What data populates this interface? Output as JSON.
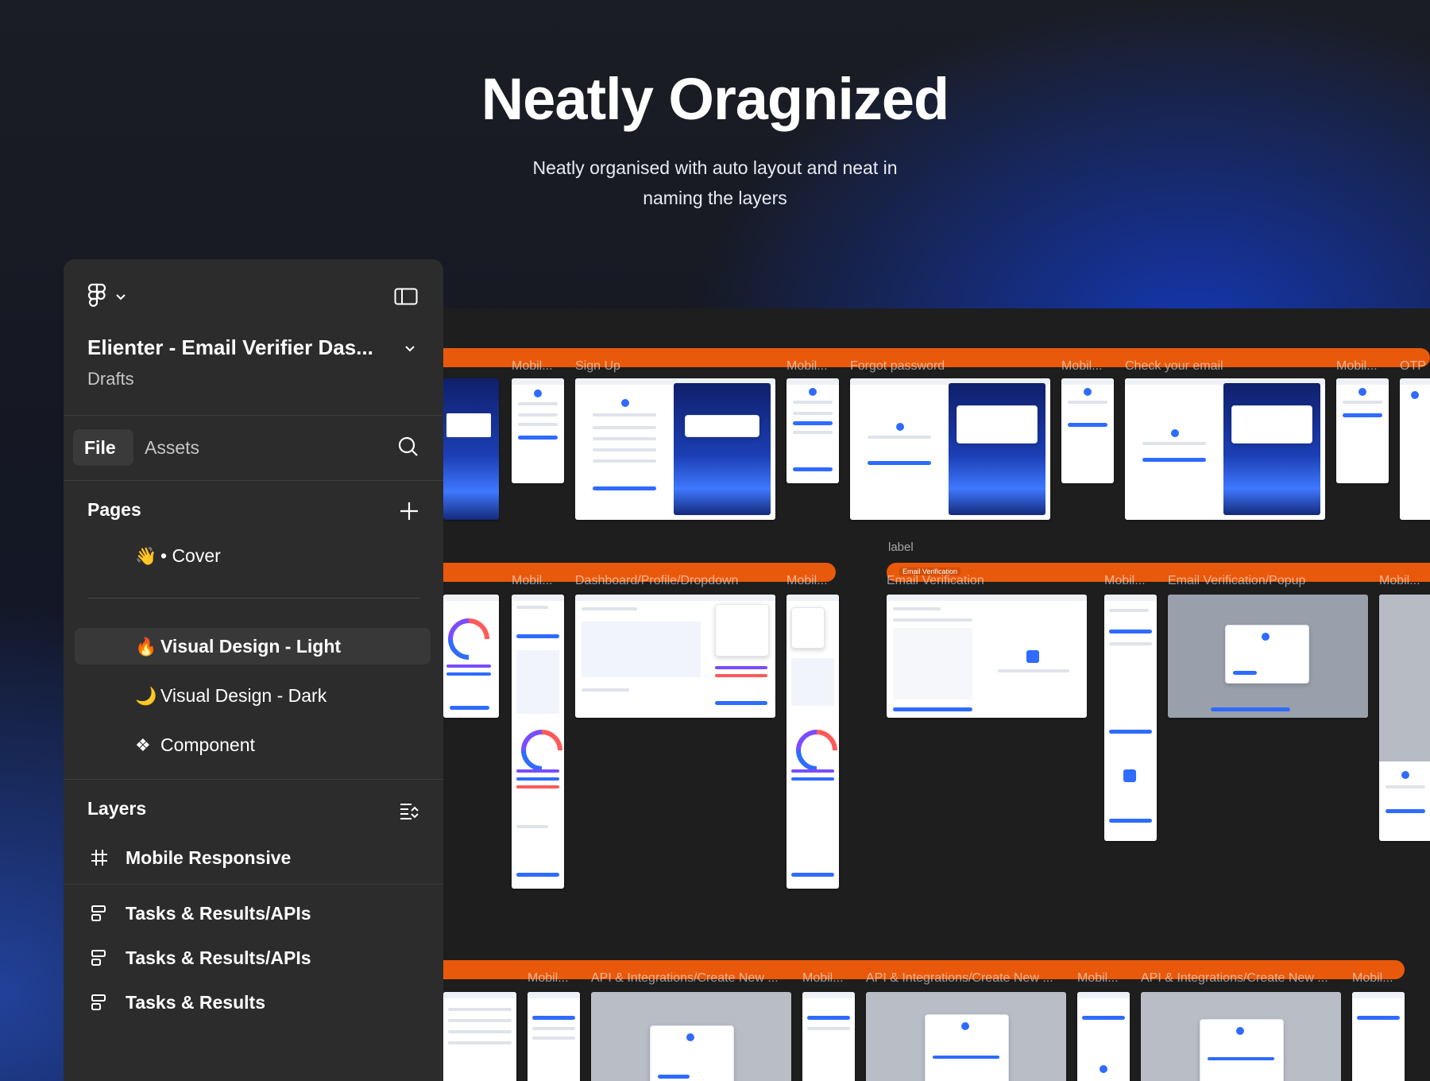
{
  "hero": {
    "title": "Neatly Oragnized",
    "subtitle_line1": "Neatly organised with auto layout and neat in",
    "subtitle_line2": "naming the layers"
  },
  "panel": {
    "file_name": "Elienter - Email Verifier Das...",
    "location": "Drafts",
    "tabs": [
      {
        "label": "File",
        "active": true
      },
      {
        "label": "Assets",
        "active": false
      }
    ],
    "pages_title": "Pages",
    "pages": [
      {
        "emoji": "👋",
        "label": "• Cover"
      },
      {
        "emoji": "🔥",
        "label": "Visual Design - Light",
        "selected": true
      },
      {
        "emoji": "🌙",
        "label": "Visual Design - Dark"
      },
      {
        "emoji": "❖",
        "label": "Component"
      }
    ],
    "layers_title": "Layers",
    "layers": [
      {
        "icon": "frame-grid-icon",
        "label": "Mobile Responsive"
      },
      {
        "icon": "auto-layout-icon",
        "label": "Tasks & Results/APIs"
      },
      {
        "icon": "auto-layout-icon",
        "label": "Tasks & Results/APIs"
      },
      {
        "icon": "auto-layout-icon",
        "label": "Tasks & Results"
      }
    ]
  },
  "canvas": {
    "row1_labels": [
      "Mobil...",
      "Sign Up",
      "Mobil...",
      "Forgot password",
      "Mobil...",
      "Check your email",
      "Mobil...",
      "OTP"
    ],
    "row2_labels": [
      "Mobil...",
      "Dashboard/Profile/Dropdown",
      "Mobil...",
      "Email Verification",
      "Mobil...",
      "Email Verification/Popup",
      "Mobil..."
    ],
    "row2_tag": "label",
    "row2_badge": "Email Verification",
    "row3_labels": [
      "Mobil...",
      "API & Integrations/Create New ...",
      "Mobil...",
      "API & Integrations/Create New ...",
      "Mobil...",
      "API & Integrations/Create New ...",
      "Mobil..."
    ],
    "section_color": "#e8590c"
  },
  "colors": {
    "accent": "#2f6bff",
    "panel": "#2c2c2c",
    "selected": "#383838"
  }
}
